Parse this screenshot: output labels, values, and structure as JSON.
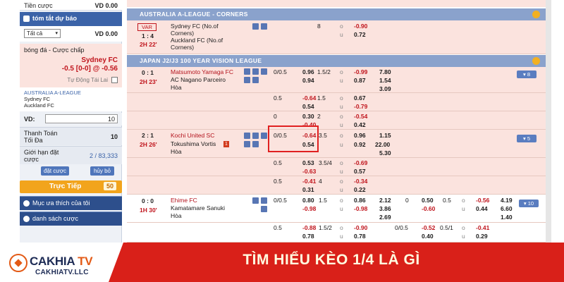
{
  "sidebar": {
    "balance_label": "Tiền cược",
    "balance_value": "VD 0.00",
    "summary_title": "tóm tắt dự báo",
    "filter_value": "Tất cả",
    "filter_amount": "VD 0.00",
    "bet_type": "bóng đá - Cược chấp",
    "selected_team": "Sydney FC",
    "selected_odds_line": "-0.5 [0-0] @ -0.56",
    "auto_accept": "Tự Động Tái Lai",
    "slip_league": "AUSTRALIA A-LEAGUE",
    "slip_home": "Sydney FC",
    "slip_away": "Auckland FC",
    "vd_label": "VD:",
    "vd_value": "10",
    "payout_label": "Thanh Toán Tối Đa",
    "payout_value": "10",
    "limit_label": "Giới hạn đặt cược",
    "limit_value": "2 / 83,333",
    "place_btn": "đặt cược",
    "cancel_btn": "hủy bỏ",
    "live_label": "Trực Tiếp",
    "live_count": "50",
    "fav_label": "Mục ưa thích của tôi",
    "list_label": "danh sách cược"
  },
  "leagues": [
    {
      "name": "AUSTRALIA A-LEAGUE - CORNERS"
    },
    {
      "name": "JAPAN J2/J3 100 YEAR VISION LEAGUE"
    }
  ],
  "matches": {
    "m1": {
      "badge": "VAR",
      "score": "1 : 4",
      "time": "2H 22'",
      "home": "Sydney FC (No.of",
      "home2": "Corners)",
      "away": "Auckland FC (No.of",
      "away2": "Corners)",
      "hdp": "8",
      "o1": "-0.90",
      "o2": "0.72"
    },
    "m2": {
      "score": "0 : 1",
      "time": "2H 23'",
      "home": "Matsumoto Yamaga FC",
      "away": "AC Nagano Parceiro",
      "draw": "Hòa",
      "hdp": "0/0.5",
      "h1": "0.96",
      "ou": "1.5/2",
      "o1": "-0.99",
      "x1": "7.80",
      "h2": "0.94",
      "o2": "0.87",
      "x2": "1.54",
      "x3": "3.09",
      "more": "▾ 8"
    },
    "m2b": {
      "hdp": "0.5",
      "h1": "-0.64",
      "ou": "1.5",
      "o1": "0.67",
      "h2": "0.54",
      "o2": "-0.79"
    },
    "m2c": {
      "hdp": "0",
      "h1": "0.30",
      "ou": "2",
      "o1": "-0.54",
      "h2": "-0.40",
      "o2": "0.42"
    },
    "m3": {
      "score": "2 : 1",
      "time": "2H 26'",
      "home": "Kochi United SC",
      "away": "Tokushima Vortis",
      "draw": "Hòa",
      "hdp": "0/0.5",
      "h1": "-0.64",
      "ou": "3.5",
      "o1": "0.96",
      "x1": "1.15",
      "h2": "0.54",
      "o2": "0.92",
      "x2": "22.00",
      "x3": "5.30",
      "more": "▾ 5"
    },
    "m3b": {
      "hdp": "0.5",
      "h1": "0.53",
      "ou": "3.5/4",
      "o1": "-0.69",
      "h2": "-0.63",
      "o2": "0.57"
    },
    "m3c": {
      "hdp": "0.5",
      "h1": "-0.41",
      "ou": "4",
      "o1": "-0.34",
      "h2": "0.31",
      "o2": "0.22"
    },
    "m4": {
      "score": "0 : 0",
      "time": "1H 30'",
      "home": "Ehime FC",
      "away": "Kamatamare Sanuki",
      "draw": "Hòa",
      "hdp": "0/0.5",
      "h1": "0.80",
      "ou": "1.5",
      "o1": "0.86",
      "x1": "2.12",
      "h2": "-0.98",
      "o2": "-0.98",
      "x2": "3.86",
      "x3": "2.69",
      "hdp2": "0",
      "fh1": "0.50",
      "fou": "0.5",
      "fo1": "-0.56",
      "fx1": "4.19",
      "fh2": "-0.60",
      "fo2": "0.44",
      "fx2": "6.60",
      "fx3": "1.40",
      "more": "▾ 10"
    },
    "m4b": {
      "hdp": "0.5",
      "h1": "-0.88",
      "ou": "1.5/2",
      "o1": "-0.90",
      "h2": "0.78",
      "o2": "0.78",
      "hdp2": "0/0.5",
      "fh1": "-0.52",
      "fou": "0.5/1",
      "fo1": "-0.41",
      "fh2": "0.40",
      "fo2": "0.29"
    }
  },
  "banner": {
    "brand": "CAKHIA",
    "brand_tv": "TV",
    "domain": "CAKHIATV.LLC",
    "title": "TÌM HIỂU KÈO 1/4 LÀ GÌ"
  },
  "colors": {
    "accent": "#3b63a8",
    "banner": "#d92019",
    "highlight": "#e02020",
    "odd_red": "#c0141c"
  }
}
